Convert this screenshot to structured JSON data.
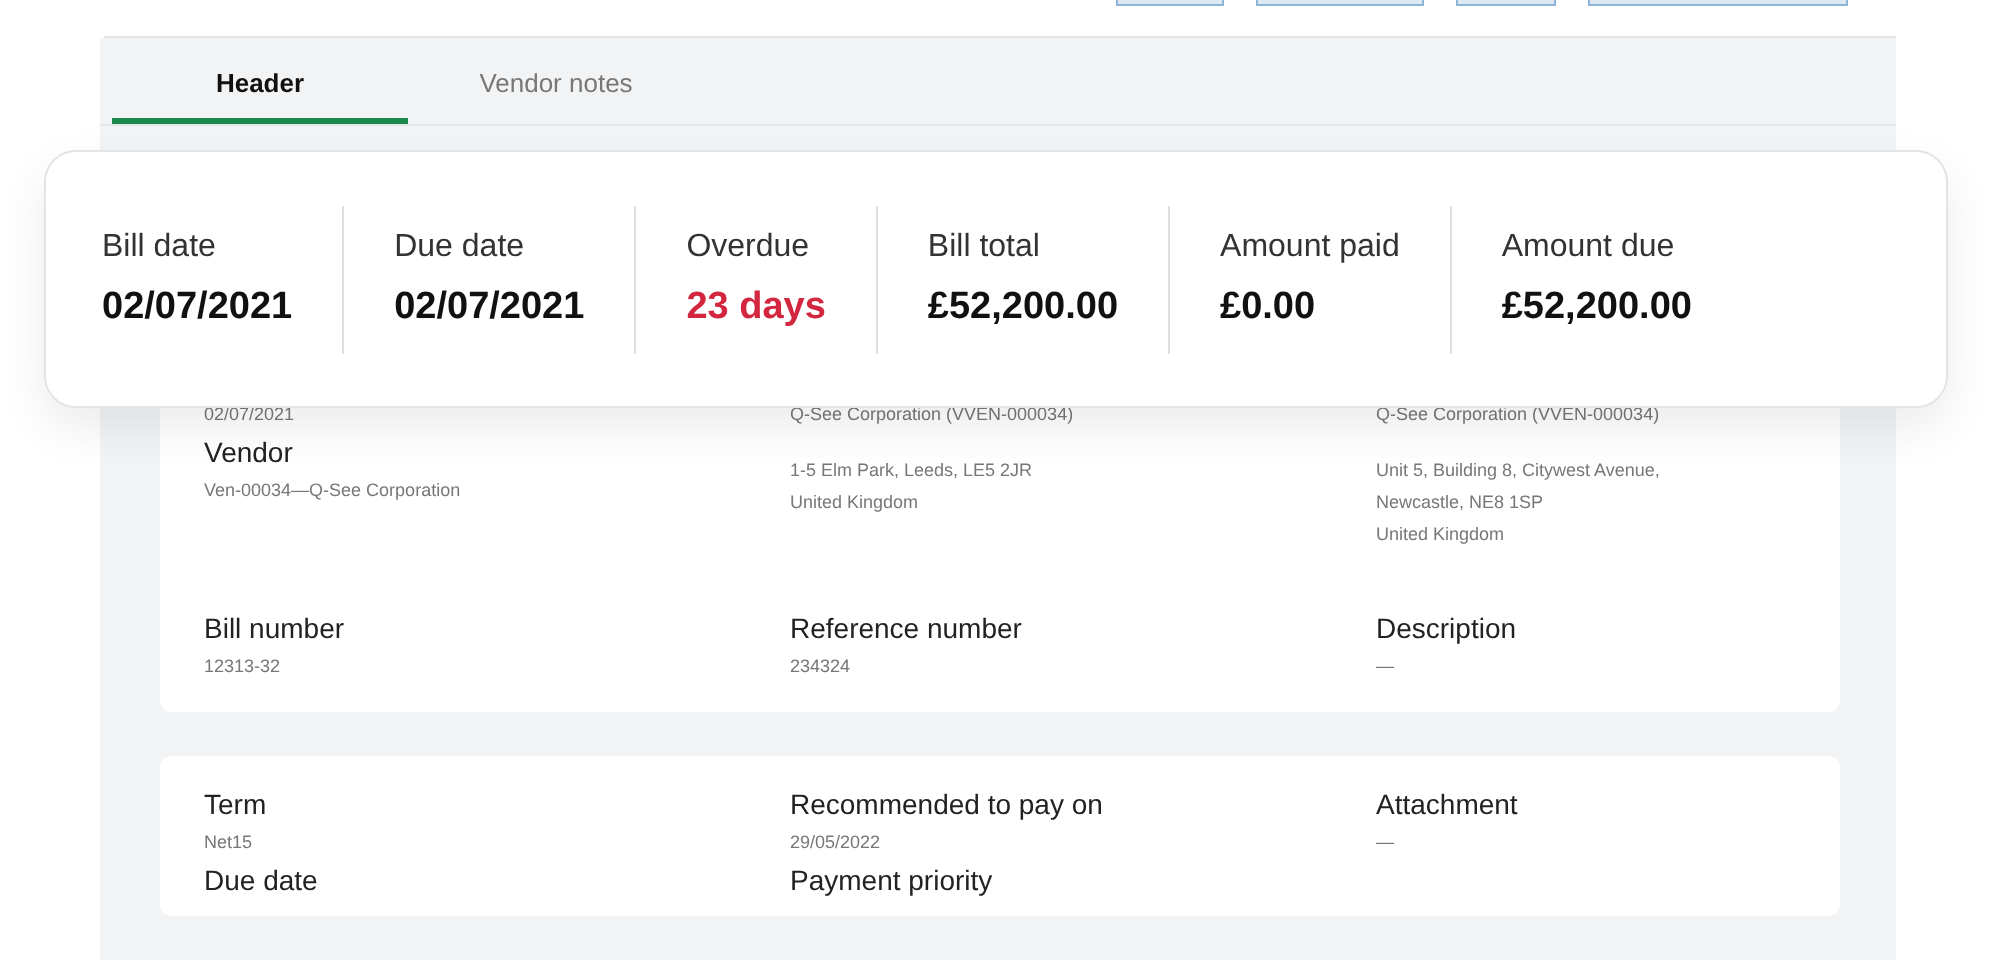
{
  "tabs": [
    {
      "label": "Header",
      "selected": true
    },
    {
      "label": "Vendor notes",
      "selected": false
    }
  ],
  "summary": [
    {
      "label": "Bill date",
      "value": "02/07/2021",
      "kind": "normal"
    },
    {
      "label": "Due date",
      "value": "02/07/2021",
      "kind": "normal"
    },
    {
      "label": "Overdue",
      "value": "23 days",
      "kind": "alert"
    },
    {
      "label": "Bill total",
      "value": "£52,200.00",
      "kind": "normal"
    },
    {
      "label": "Amount paid",
      "value": "£0.00",
      "kind": "normal"
    },
    {
      "label": "Amount due",
      "value": "£52,200.00",
      "kind": "normal"
    }
  ],
  "cards": [
    {
      "rows": [
        [
          {
            "items": [
              {
                "kind": "value",
                "text": "02/07/2021"
              },
              {
                "kind": "label",
                "text": "Vendor"
              },
              {
                "kind": "value",
                "text": "Ven-00034—Q-See Corporation"
              }
            ]
          },
          {
            "items": [
              {
                "kind": "value",
                "text": "Q-See Corporation (VVEN-000034)"
              },
              {
                "kind": "address",
                "text": "1-5 Elm Park, Leeds, LE5 2JR"
              },
              {
                "kind": "value",
                "text": "United Kingdom"
              }
            ]
          },
          {
            "items": [
              {
                "kind": "value",
                "text": "Q-See Corporation (VVEN-000034)"
              },
              {
                "kind": "address",
                "text": "Unit 5, Building 8, Citywest Avenue,"
              },
              {
                "kind": "value",
                "text": "Newcastle, NE8 1SP"
              },
              {
                "kind": "value",
                "text": "United Kingdom"
              }
            ]
          }
        ],
        [
          {
            "items": [
              {
                "kind": "label",
                "text": "Bill number"
              },
              {
                "kind": "value",
                "text": "12313-32"
              }
            ]
          },
          {
            "items": [
              {
                "kind": "label",
                "text": "Reference number"
              },
              {
                "kind": "value",
                "text": "234324"
              }
            ]
          },
          {
            "items": [
              {
                "kind": "label",
                "text": "Description"
              },
              {
                "kind": "value",
                "text": "—"
              }
            ]
          }
        ]
      ]
    },
    {
      "rows": [
        [
          {
            "items": [
              {
                "kind": "label",
                "text": "Term"
              },
              {
                "kind": "value",
                "text": "Net15"
              }
            ]
          },
          {
            "items": [
              {
                "kind": "label",
                "text": "Recommended to pay on"
              },
              {
                "kind": "value",
                "text": "29/05/2022"
              }
            ]
          },
          {
            "items": [
              {
                "kind": "label",
                "text": "Attachment"
              },
              {
                "kind": "value",
                "text": "—"
              }
            ]
          }
        ],
        [
          {
            "items": [
              {
                "kind": "label",
                "text": "Due date"
              }
            ]
          },
          {
            "items": [
              {
                "kind": "label",
                "text": "Payment priority"
              }
            ]
          }
        ]
      ]
    }
  ]
}
